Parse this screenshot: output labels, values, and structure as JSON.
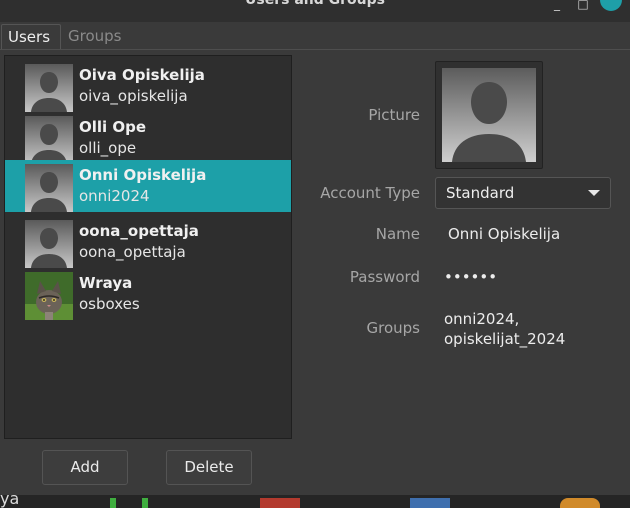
{
  "window": {
    "title": "Users and Groups"
  },
  "tabs": [
    {
      "label": "Users",
      "active": true
    },
    {
      "label": "Groups",
      "active": false
    }
  ],
  "users": [
    {
      "name": "Oiva Opiskelija",
      "login": "oiva_opiskelija",
      "avatar": "default-avatar-icon",
      "selected": false
    },
    {
      "name": "Olli Ope",
      "login": "olli_ope",
      "avatar": "default-avatar-icon",
      "selected": false
    },
    {
      "name": "Onni Opiskelija",
      "login": "onni2024",
      "avatar": "default-avatar-icon",
      "selected": true
    },
    {
      "name": "oona_opettaja",
      "login": "oona_opettaja",
      "avatar": "default-avatar-icon",
      "selected": false
    },
    {
      "name": "Wraya",
      "login": "osboxes",
      "avatar": "kitten-photo",
      "selected": false
    }
  ],
  "buttons": {
    "add": "Add",
    "delete": "Delete"
  },
  "details": {
    "picture_label": "Picture",
    "account_type_label": "Account Type",
    "account_type_value": "Standard",
    "name_label": "Name",
    "name_value": "Onni Opiskelija",
    "password_label": "Password",
    "password_value": "••••••",
    "groups_label": "Groups",
    "groups_line1": "onni2024,",
    "groups_line2": "opiskelijat_2024"
  },
  "taskbar": {
    "fragment": "ya"
  },
  "colors": {
    "selection": "#1da0a8",
    "background": "#3a3a3a",
    "list_background": "#2e2e2e"
  }
}
